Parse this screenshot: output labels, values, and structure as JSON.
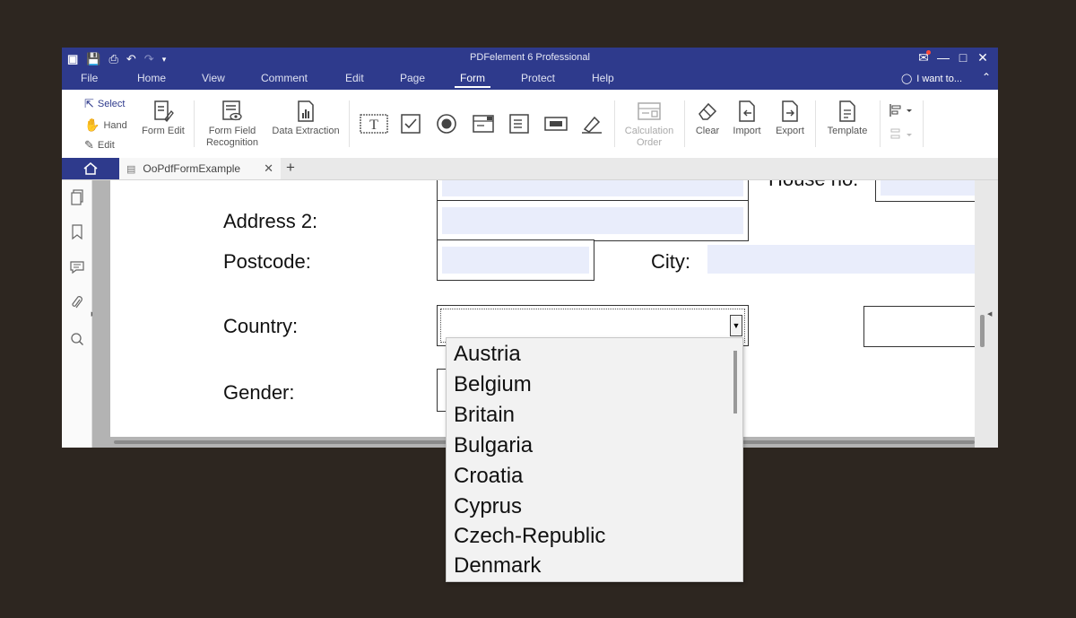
{
  "app": {
    "title": "PDFelement 6 Professional"
  },
  "menu": {
    "items": [
      "File",
      "Home",
      "View",
      "Comment",
      "Edit",
      "Page",
      "Form",
      "Protect",
      "Help"
    ],
    "active": "Form",
    "search_label": "I want to..."
  },
  "ribbon": {
    "select": "Select",
    "hand": "Hand",
    "edit": "Edit",
    "form_edit": "Form Edit",
    "form_field_recognition_1": "Form Field",
    "form_field_recognition_2": "Recognition",
    "data_extraction": "Data Extraction",
    "calculation_order_1": "Calculation",
    "calculation_order_2": "Order",
    "clear": "Clear",
    "import": "Import",
    "export": "Export",
    "template": "Template"
  },
  "tabs": {
    "document": "OoPdfFormExample"
  },
  "form": {
    "house_no_label": "House no:",
    "address2_label": "Address 2:",
    "postcode_label": "Postcode:",
    "city_label": "City:",
    "country_label": "Country:",
    "gender_label": "Gender:"
  },
  "country_dropdown": {
    "selected": "",
    "options": [
      "Austria",
      "Belgium",
      "Britain",
      "Bulgaria",
      "Croatia",
      "Cyprus",
      "Czech-Republic",
      "Denmark"
    ]
  },
  "colors": {
    "accent": "#2e3a8c",
    "background": "#2d2620",
    "field_fill": "#e9edfb"
  }
}
